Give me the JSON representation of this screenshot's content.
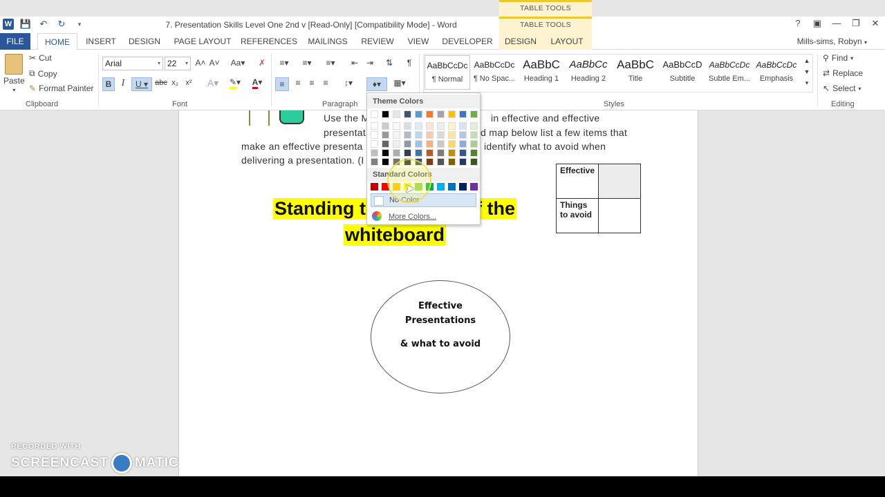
{
  "window": {
    "title": "7. Presentation Skills Level One 2nd v [Read-Only] [Compatibility Mode] - Word",
    "context_tab_group": "TABLE TOOLS",
    "user": "Mills-sims, Robyn"
  },
  "tabs": [
    "FILE",
    "HOME",
    "INSERT",
    "DESIGN",
    "PAGE LAYOUT",
    "REFERENCES",
    "MAILINGS",
    "REVIEW",
    "VIEW",
    "DEVELOPER",
    "DESIGN",
    "LAYOUT"
  ],
  "ribbon": {
    "clipboard": {
      "paste": "Paste",
      "cut": "Cut",
      "copy": "Copy",
      "format_painter": "Format Painter",
      "label": "Clipboard"
    },
    "font": {
      "name": "Arial",
      "size": "22",
      "label": "Font"
    },
    "paragraph": {
      "label": "Paragraph"
    },
    "styles": {
      "label": "Styles",
      "items": [
        {
          "preview": "AaBbCcDc",
          "name": "¶ Normal"
        },
        {
          "preview": "AaBbCcDc",
          "name": "¶ No Spac..."
        },
        {
          "preview": "AaBbC",
          "name": "Heading 1"
        },
        {
          "preview": "AaBbCc",
          "name": "Heading 2"
        },
        {
          "preview": "AaBbC",
          "name": "Title"
        },
        {
          "preview": "AaBbCcD",
          "name": "Subtitle"
        },
        {
          "preview": "AaBbCcDc",
          "name": "Subtle Em..."
        },
        {
          "preview": "AaBbCcDc",
          "name": "Emphasis"
        }
      ]
    },
    "editing": {
      "find": "Find",
      "replace": "Replace",
      "select": "Select",
      "label": "Editing"
    }
  },
  "document": {
    "lines": [
      "Use the M",
      "in effective and effective",
      "presentat",
      "d map below list a few items that",
      "make an effective presenta",
      "identify what to avoid when",
      "delivering a presentation. (I"
    ],
    "heading_line1_left": "Standing t",
    "heading_line1_right": "f the",
    "heading_line2": "whiteboard",
    "table": {
      "r1": "Effective",
      "r2": "Things to avoid"
    },
    "ellipse": {
      "line1": "Effective",
      "line2": "Presentations",
      "line3": "& what to avoid"
    }
  },
  "color_dropdown": {
    "theme_header": "Theme Colors",
    "standard_header": "Standard Colors",
    "no_color": "No Color",
    "more_colors": "More Colors...",
    "theme_top": [
      "#ffffff",
      "#000000",
      "#e7e6e6",
      "#44546a",
      "#5b9bd5",
      "#ed7d31",
      "#a5a5a5",
      "#ffc000",
      "#4472c4",
      "#70ad47"
    ],
    "standard": [
      "#c00000",
      "#ff0000",
      "#ffc000",
      "#ffff00",
      "#92d050",
      "#00b050",
      "#00b0f0",
      "#0070c0",
      "#002060",
      "#7030a0"
    ]
  },
  "watermark": {
    "line1": "RECORDED WITH",
    "line2a": "SCREENCAST",
    "line2b": "MATIC"
  }
}
